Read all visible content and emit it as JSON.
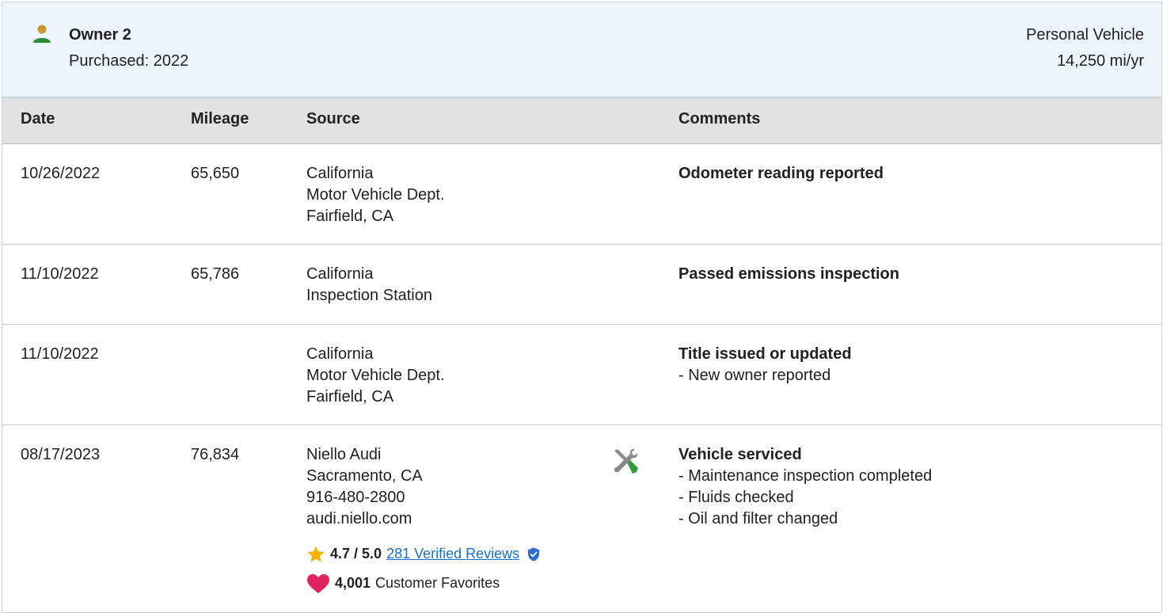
{
  "owner": {
    "title": "Owner 2",
    "purchased": "Purchased: 2022",
    "vehicle_type": "Personal Vehicle",
    "miles_per_year": "14,250 mi/yr"
  },
  "table": {
    "headers": {
      "date": "Date",
      "mileage": "Mileage",
      "source": "Source",
      "comments": "Comments"
    },
    "rows": [
      {
        "date": "10/26/2022",
        "mileage": "65,650",
        "source": [
          "California",
          "Motor Vehicle Dept.",
          "Fairfield, CA"
        ],
        "comment_title": "Odometer reading reported",
        "comment_details": []
      },
      {
        "date": "11/10/2022",
        "mileage": "65,786",
        "source": [
          "California",
          "Inspection Station"
        ],
        "comment_title": "Passed emissions inspection",
        "comment_details": []
      },
      {
        "date": "11/10/2022",
        "mileage": "",
        "source": [
          "California",
          "Motor Vehicle Dept.",
          "Fairfield, CA"
        ],
        "comment_title": "Title issued or updated",
        "comment_details": [
          "- New owner reported"
        ]
      },
      {
        "date": "08/17/2023",
        "mileage": "76,834",
        "source": [
          "Niello Audi",
          "Sacramento, CA",
          "916-480-2800",
          "audi.niello.com"
        ],
        "icon": "service-tools-icon",
        "comment_title": "Vehicle serviced",
        "comment_details": [
          "- Maintenance inspection completed",
          "- Fluids checked",
          "- Oil and filter changed"
        ],
        "rating": {
          "score": "4.7 / 5.0",
          "reviews_link": "281 Verified Reviews",
          "rating_fraction": 0.94
        },
        "favorites": {
          "count": "4,001",
          "label": "Customer Favorites"
        }
      }
    ]
  },
  "colors": {
    "owner_icon_head": "#c99a2e",
    "owner_icon_body": "#2e8b3a",
    "star": "#f5b400",
    "heart": "#e0245e",
    "link": "#1a6fc9",
    "verified_badge": "#2f6ed1",
    "wrench_handle": "#2e9e3a"
  }
}
